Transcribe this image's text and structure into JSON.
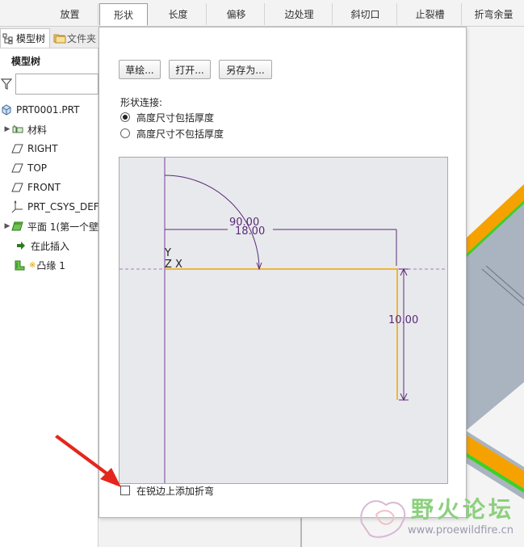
{
  "ribbon": {
    "tabs": [
      "放置",
      "形状",
      "长度",
      "偏移",
      "边处理",
      "斜切口",
      "止裂槽",
      "折弯余量"
    ],
    "active_index": 1
  },
  "left_panel": {
    "tabs": [
      "模型树",
      "文件夹"
    ],
    "tree_title": "模型树",
    "filter_value": "",
    "items": [
      {
        "label": "PRT0001.PRT",
        "icon": "part-icon",
        "expandable": false
      },
      {
        "label": "材料",
        "icon": "material-icon",
        "expandable": true
      },
      {
        "label": "RIGHT",
        "icon": "datum-plane-icon",
        "expandable": false
      },
      {
        "label": "TOP",
        "icon": "datum-plane-icon",
        "expandable": false
      },
      {
        "label": "FRONT",
        "icon": "datum-plane-icon",
        "expandable": false
      },
      {
        "label": "PRT_CSYS_DEF",
        "icon": "csys-icon",
        "expandable": false
      },
      {
        "label": "平面 1(第一个壁",
        "icon": "flat-wall-icon",
        "expandable": true
      },
      {
        "label": "在此插入",
        "icon": "insert-here-icon",
        "expandable": false
      },
      {
        "label": "凸缘 1",
        "icon": "flange-icon",
        "expandable": false
      }
    ]
  },
  "dialog": {
    "buttons": {
      "sketch": "草绘...",
      "open": "打开...",
      "save_as": "另存为..."
    },
    "shape_connection_label": "形状连接:",
    "radio_options": [
      {
        "label": "高度尺寸包括厚度",
        "checked": true
      },
      {
        "label": "高度尺寸不包括厚度",
        "checked": false
      }
    ],
    "sketch_preview": {
      "angle_dim": "90.00",
      "length_dim": "18.00",
      "height_dim": "10.00",
      "axis_y": "Y",
      "axis_zx": "Z X"
    },
    "checkbox": {
      "label": "在锐边上添加折弯",
      "checked": false
    }
  },
  "watermark": {
    "title": "野火论坛",
    "url": "www.proewildfire.cn"
  },
  "colors": {
    "sketch_bg": "#e8e9ec",
    "geometry_orange": "#f0a500",
    "dimension_purple": "#5a2a78",
    "part_orange": "#f5a200",
    "part_green": "#3ecf2a",
    "part_gray": "#a9b4c0",
    "arrow_red": "#e5261c"
  }
}
